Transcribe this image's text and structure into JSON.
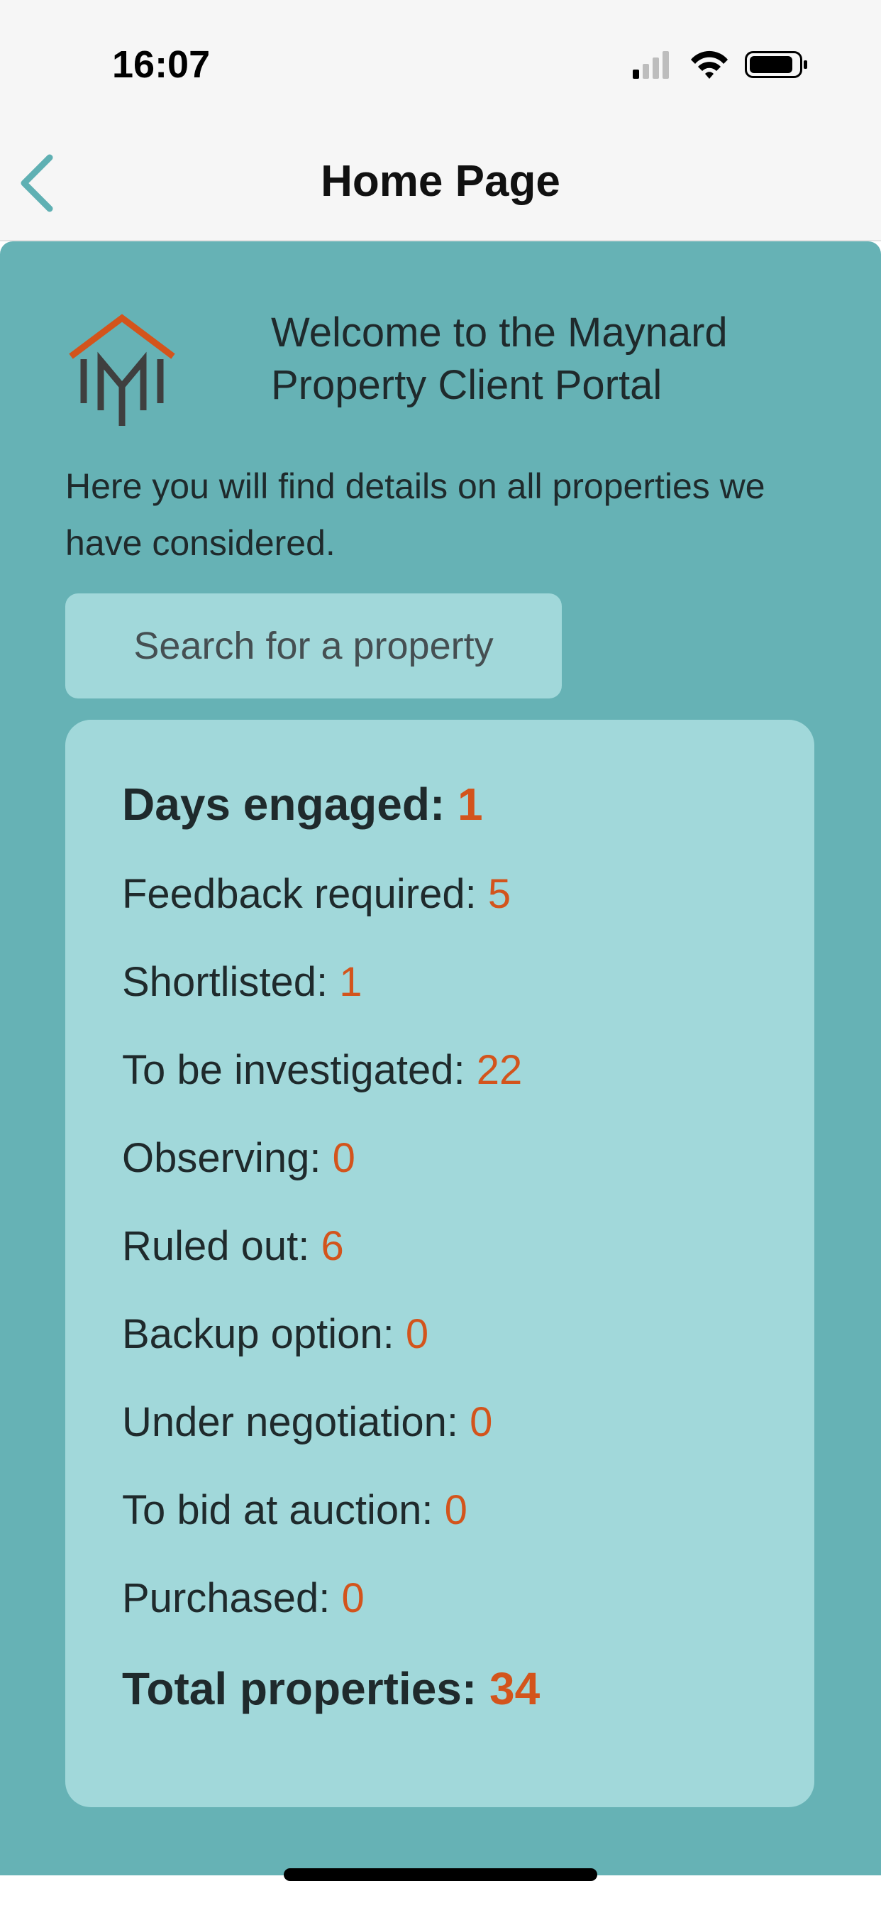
{
  "status_bar": {
    "time": "16:07"
  },
  "nav": {
    "title": "Home Page"
  },
  "welcome": {
    "line1": "Welcome to the Maynard",
    "line2": "Property Client Portal"
  },
  "intro": "Here you will find details on all properties we have considered.",
  "search": {
    "label": "Search for a property"
  },
  "stats": {
    "days_engaged": {
      "label": "Days engaged:",
      "value": "1"
    },
    "feedback_required": {
      "label": "Feedback required:",
      "value": "5"
    },
    "shortlisted": {
      "label": "Shortlisted:",
      "value": "1"
    },
    "to_be_investigated": {
      "label": "To be investigated:",
      "value": "22"
    },
    "observing": {
      "label": "Observing:",
      "value": "0"
    },
    "ruled_out": {
      "label": "Ruled out:",
      "value": "6"
    },
    "backup_option": {
      "label": "Backup option:",
      "value": "0"
    },
    "under_negotiation": {
      "label": "Under negotiation:",
      "value": "0"
    },
    "to_bid_at_auction": {
      "label": "To bid at auction:",
      "value": "0"
    },
    "purchased": {
      "label": "Purchased:",
      "value": "0"
    },
    "total_properties": {
      "label": "Total properties:",
      "value": "34"
    }
  },
  "colors": {
    "accent": "#d3541c",
    "background": "#66b2b5",
    "card": "#a1d8da",
    "back_arrow": "#5fb0b3"
  },
  "icons": {
    "back": "chevron-left-icon",
    "signal": "cellular-signal-icon",
    "wifi": "wifi-icon",
    "battery": "battery-icon",
    "logo": "maynard-logo"
  }
}
